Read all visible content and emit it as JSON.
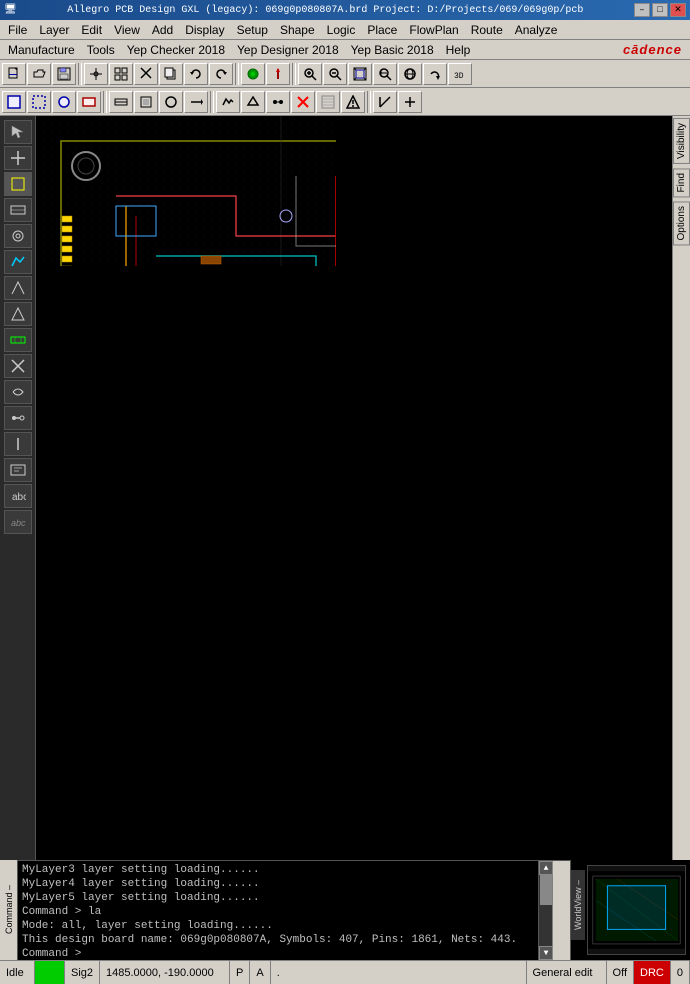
{
  "titlebar": {
    "title": "Allegro PCB Design GXL (legacy): 069g0p080807A.brd  Project: D:/Projects/069/069g0p/pcb",
    "min": "–",
    "max": "□",
    "close": "✕"
  },
  "menubar1": {
    "items": [
      "File",
      "Layer",
      "Edit",
      "View",
      "Add",
      "Display",
      "Setup",
      "Shape",
      "Logic",
      "Place",
      "FlowPlan",
      "Route",
      "Analyze"
    ]
  },
  "menubar2": {
    "items": [
      "Manufacture",
      "Tools",
      "Yep Checker 2018",
      "Yep Designer 2018",
      "Yep Basic 2018",
      "Help"
    ]
  },
  "cadence": {
    "logo": "cādence"
  },
  "right_panel": {
    "tabs": [
      "Visibility",
      "Find",
      "Options"
    ]
  },
  "console": {
    "lines": [
      "MyLayer3 layer setting loading......",
      "MyLayer4 layer setting loading......",
      "MyLayer5 layer setting loading......",
      "Command > la",
      "Mode: all, layer setting loading......",
      "This design board name: 069g0p080807A, Symbols: 407, Pins: 1861, Nets: 443.",
      "Command >"
    ],
    "left_label": "Command –"
  },
  "worldview": {
    "label": "WorldView –"
  },
  "statusbar": {
    "idle": "Idle",
    "green": "",
    "sig2": "Sig2",
    "coords": "1485.0000, -190.0000",
    "p": "P",
    "a": "A",
    "dot": ".",
    "general_edit": "General edit",
    "off": "Off",
    "red": "DRC",
    "zero": "0"
  },
  "toolbar1_icons": [
    "📁",
    "💾",
    "🖨",
    "✂",
    "📋",
    "↩",
    "↪",
    "⬛",
    "🖊",
    "🔵",
    "📍",
    "🔎",
    "🔍",
    "⊕",
    "⊖",
    "⤢",
    "↕",
    "↔",
    "🔄",
    "3D"
  ],
  "toolbar2_icons": [
    "⬜",
    "⬜",
    "⬜",
    "⬜",
    "⬜",
    "⬜",
    "⬜",
    "⬜",
    "◯",
    "→",
    "⬜",
    "⬜",
    "⬜",
    "⬜",
    "⬜",
    "⬜",
    "⬜",
    "⊠",
    "⬜",
    "⬜",
    "⬜",
    "⬜"
  ],
  "left_toolbar_icons": [
    "↖",
    "↕",
    "⬚",
    "⬚",
    "⬚",
    "⬚",
    "⬚",
    "⬚",
    "⬚",
    "⬚",
    "⬚",
    "⬚",
    "⬚",
    "⬚",
    "⬚",
    "⬚",
    "abc",
    "abc"
  ]
}
